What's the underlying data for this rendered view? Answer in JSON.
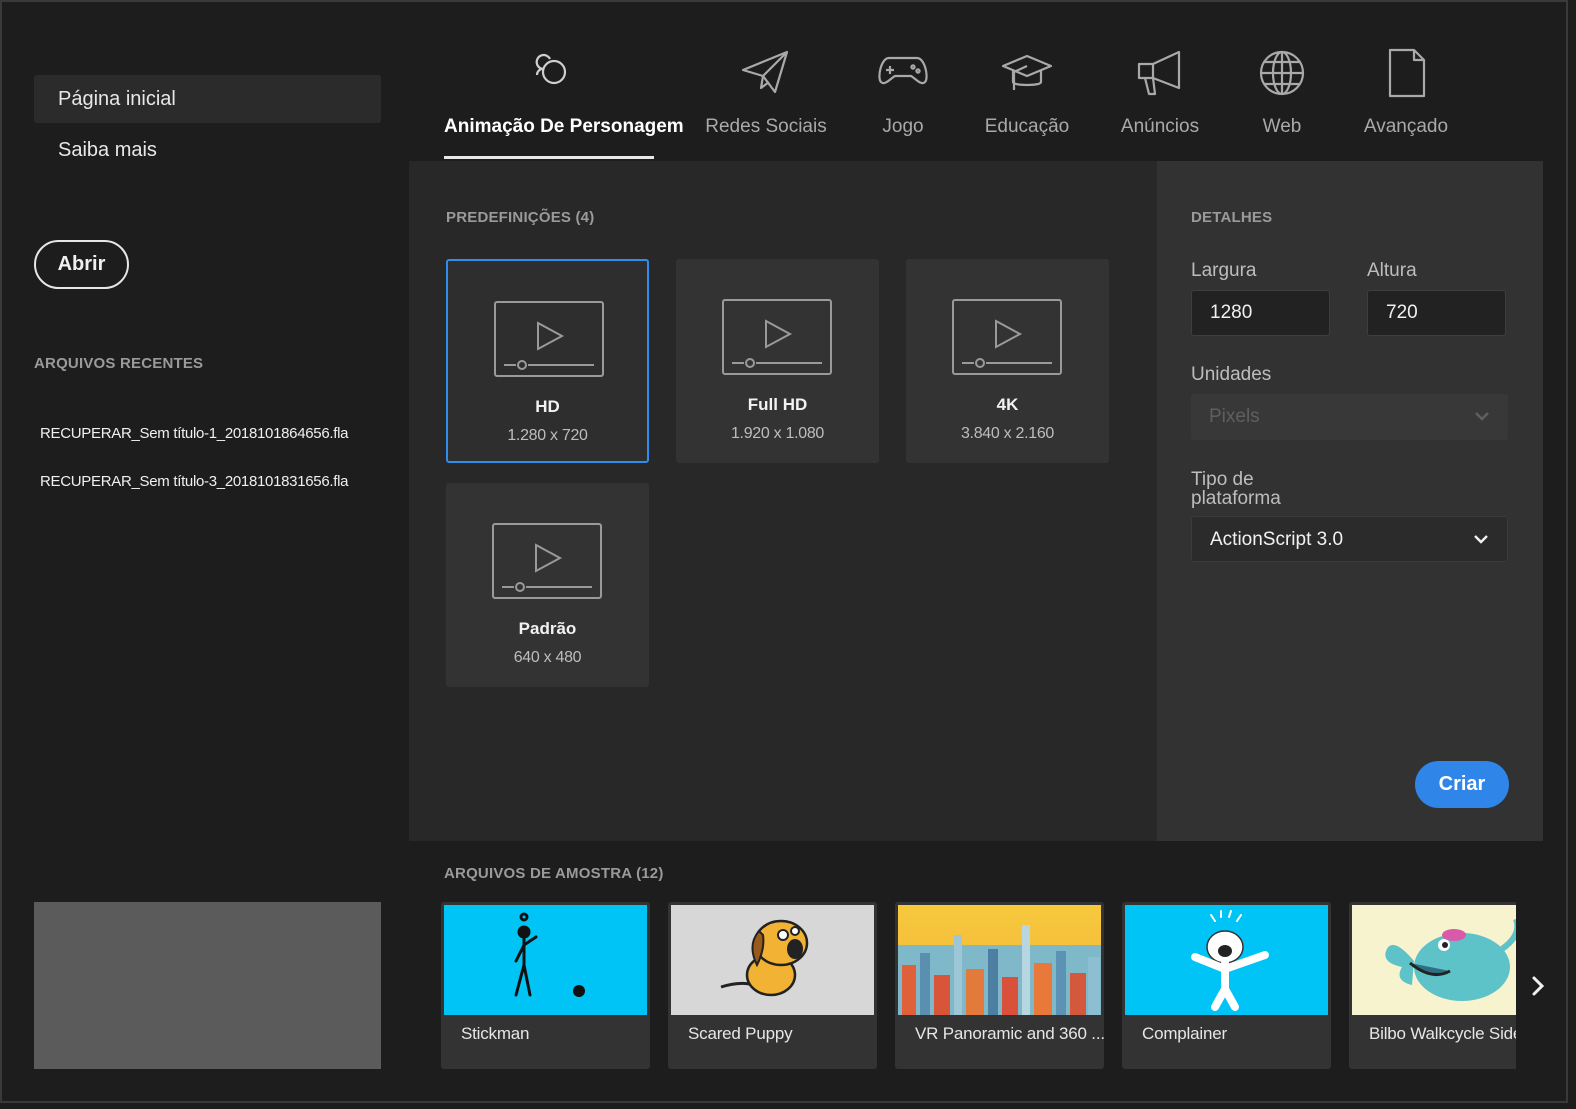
{
  "sidebar": {
    "nav": [
      {
        "label": "Página inicial",
        "active": true
      },
      {
        "label": "Saiba mais",
        "active": false
      }
    ],
    "open_label": "Abrir",
    "recent_heading": "ARQUIVOS RECENTES",
    "recent_files": [
      "RECUPERAR_Sem título-1_2018101864656.fla",
      "RECUPERAR_Sem título-3_2018101831656.fla"
    ]
  },
  "tabs": [
    {
      "label": "Animação De Personagem",
      "icon": "character-animation-icon",
      "active": true
    },
    {
      "label": "Redes Sociais",
      "icon": "paper-plane-icon"
    },
    {
      "label": "Jogo",
      "icon": "gamepad-icon"
    },
    {
      "label": "Educação",
      "icon": "graduation-cap-icon"
    },
    {
      "label": "Anúncios",
      "icon": "megaphone-icon"
    },
    {
      "label": "Web",
      "icon": "globe-icon"
    },
    {
      "label": "Avançado",
      "icon": "document-icon"
    }
  ],
  "presets": {
    "heading": "PREDEFINIÇÕES (4)",
    "items": [
      {
        "name": "HD",
        "size": "1.280 x 720",
        "selected": true
      },
      {
        "name": "Full HD",
        "size": "1.920 x 1.080"
      },
      {
        "name": "4K",
        "size": "3.840 x 2.160"
      },
      {
        "name": "Padrão",
        "size": "640 x 480"
      }
    ]
  },
  "details": {
    "heading": "DETALHES",
    "width_label": "Largura",
    "width_value": "1280",
    "height_label": "Altura",
    "height_value": "720",
    "units_label": "Unidades",
    "units_value": "Pixels",
    "platform_label_line1": "Tipo de",
    "platform_label_line2": "plataforma",
    "platform_value": "ActionScript 3.0",
    "create_label": "Criar"
  },
  "samples": {
    "heading": "ARQUIVOS DE AMOSTRA (12)",
    "items": [
      {
        "title": "Stickman"
      },
      {
        "title": "Scared Puppy"
      },
      {
        "title": "VR Panoramic and 360 ..."
      },
      {
        "title": "Complainer"
      },
      {
        "title": "Bilbo Walkcycle Side"
      }
    ]
  },
  "colors": {
    "accent": "#2f86e8",
    "background": "#1d1d1d",
    "panel": "#282828",
    "sample_sky": "#00c4f5"
  }
}
